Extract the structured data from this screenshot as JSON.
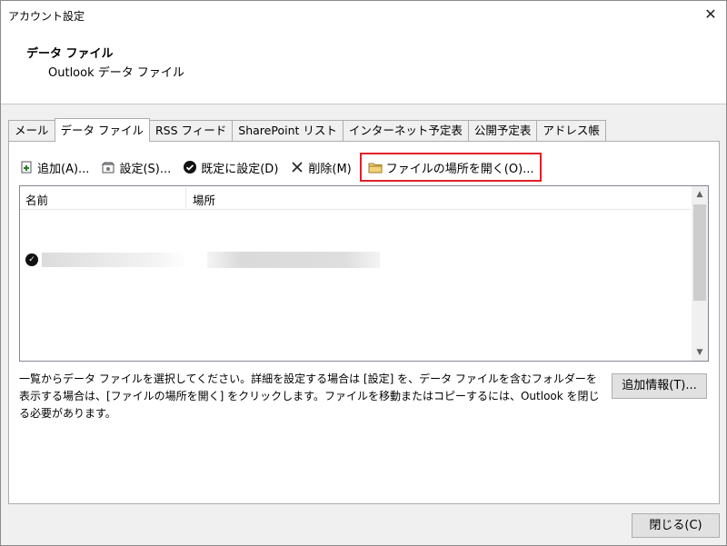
{
  "window": {
    "title": "アカウント設定",
    "close_glyph": "✕"
  },
  "section": {
    "title": "データ ファイル",
    "subtitle": "Outlook データ ファイル"
  },
  "tabs": [
    {
      "label": "メール"
    },
    {
      "label": "データ ファイル",
      "active": true
    },
    {
      "label": "RSS フィード"
    },
    {
      "label": "SharePoint リスト"
    },
    {
      "label": "インターネット予定表"
    },
    {
      "label": "公開予定表"
    },
    {
      "label": "アドレス帳"
    }
  ],
  "toolbar": {
    "add": {
      "label": "追加(A)...",
      "icon": "add-file-icon"
    },
    "settings": {
      "label": "設定(S)...",
      "icon": "settings-icon"
    },
    "default": {
      "label": "既定に設定(D)",
      "icon": "check-circle-icon"
    },
    "delete": {
      "label": "削除(M)",
      "icon": "x-icon"
    },
    "open_location": {
      "label": "ファイルの場所を開く(O)...",
      "icon": "folder-icon",
      "highlight_color": "#e0202a"
    }
  },
  "list": {
    "columns": [
      {
        "label": "名前"
      },
      {
        "label": "場所"
      }
    ],
    "rows": [
      {
        "is_default": true
      }
    ]
  },
  "description": "一覧からデータ ファイルを選択してください。詳細を設定する場合は [設定] を、データ ファイルを含むフォルダーを表示する場合は、[ファイルの場所を開く] をクリックします。ファイルを移動またはコピーするには、Outlook を閉じる必要があります。",
  "buttons": {
    "more_info": "追加情報(T)...",
    "close": "閉じる(C)"
  }
}
